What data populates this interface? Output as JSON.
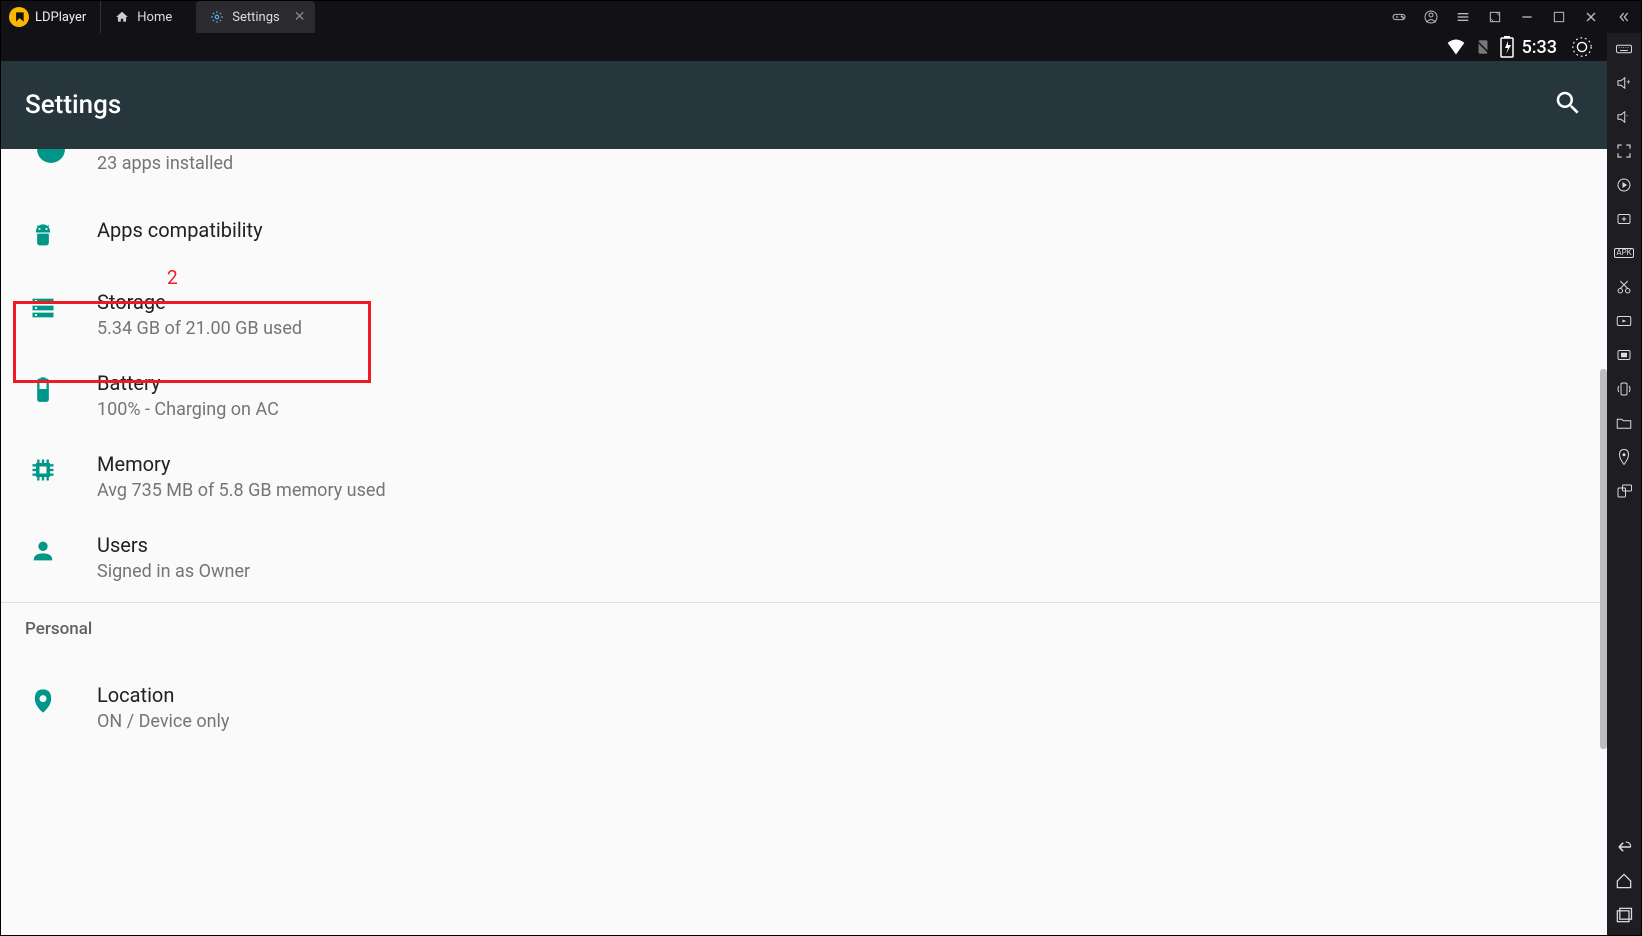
{
  "titlebar": {
    "app_name": "LDPlayer",
    "tabs": [
      {
        "label": "Home",
        "active": false
      },
      {
        "label": "Settings",
        "active": true
      }
    ]
  },
  "statusbar": {
    "time": "5:33"
  },
  "toolbar": {
    "title": "Settings"
  },
  "settings_items": {
    "apps_partial": {
      "secondary": "23 apps installed"
    },
    "apps_compat": {
      "title": "Apps compatibility"
    },
    "storage": {
      "title": "Storage",
      "secondary": "5.34 GB of 21.00 GB used"
    },
    "battery": {
      "title": "Battery",
      "secondary": "100% - Charging on AC"
    },
    "memory": {
      "title": "Memory",
      "secondary": "Avg 735 MB of 5.8 GB memory used"
    },
    "users": {
      "title": "Users",
      "secondary": "Signed in as Owner"
    },
    "personal_header": "Personal",
    "location": {
      "title": "Location",
      "secondary": "ON / Device only"
    }
  },
  "annotation": {
    "label": "2"
  },
  "sidebar_right_apk": "APK"
}
